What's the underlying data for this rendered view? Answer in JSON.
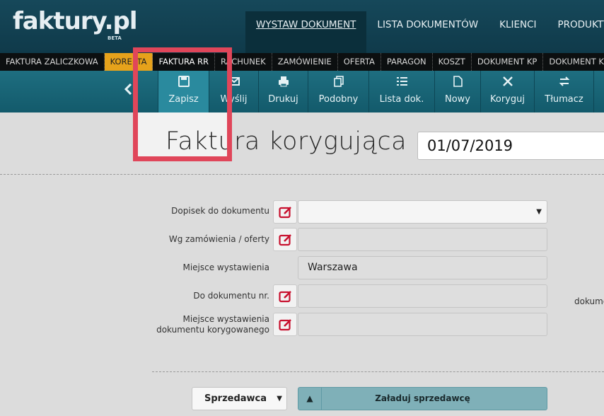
{
  "logo": {
    "text": "faktury.pl",
    "badge": "BETA"
  },
  "main_nav": [
    {
      "label": "WYSTAW DOKUMENT",
      "active": true
    },
    {
      "label": "LISTA DOKUMENTÓW",
      "active": false
    },
    {
      "label": "KLIENCI",
      "active": false
    },
    {
      "label": "PRODUKTY",
      "active": false
    }
  ],
  "doc_tabs": [
    {
      "label": "FAKTURA ZALICZKOWA"
    },
    {
      "label": "KOREKTA"
    },
    {
      "label": "FAKTURA RR"
    },
    {
      "label": "RACHUNEK"
    },
    {
      "label": "ZAMÓWIENIE"
    },
    {
      "label": "OFERTA"
    },
    {
      "label": "PARAGON"
    },
    {
      "label": "KOSZT"
    },
    {
      "label": "DOKUMENT KP"
    },
    {
      "label": "DOKUMENT KW"
    }
  ],
  "toolbar": {
    "buttons": [
      {
        "label": "Zapisz",
        "icon": "floppy-disk-icon"
      },
      {
        "label": "Wyślij",
        "icon": "envelope-icon"
      },
      {
        "label": "Drukuj",
        "icon": "printer-icon"
      },
      {
        "label": "Podobny",
        "icon": "copy-icon"
      },
      {
        "label": "Lista dok.",
        "icon": "list-icon"
      },
      {
        "label": "Nowy",
        "icon": "new-document-icon"
      },
      {
        "label": "Koryguj",
        "icon": "tools-icon"
      },
      {
        "label": "Tłumacz",
        "icon": "swap-icon"
      }
    ]
  },
  "document": {
    "title": "Faktura korygująca nr",
    "number": "01/07/2019"
  },
  "form": {
    "note_label": "Dopisek do dokumentu",
    "note_value": "",
    "order_label": "Wg zamówienia / oferty",
    "order_value": "",
    "place_label": "Miejsce wystawienia",
    "place_value": "Warszawa",
    "ref_doc_label": "Do dokumentu nr.",
    "ref_doc_value": "",
    "ref_place_label_line1": "Miejsce wystawienia",
    "ref_place_label_line2": "dokumentu korygowanego",
    "ref_place_value": "",
    "side_note": "dokume"
  },
  "seller": {
    "select_value": "Sprzedawca",
    "load_label": "Załaduj sprzedawcę"
  },
  "colors": {
    "header": "#16485a",
    "toolbar": "#1e6e80",
    "active_tab": "#e6a21b",
    "highlight": "#e0465a",
    "edit_icon": "#c8102e"
  }
}
